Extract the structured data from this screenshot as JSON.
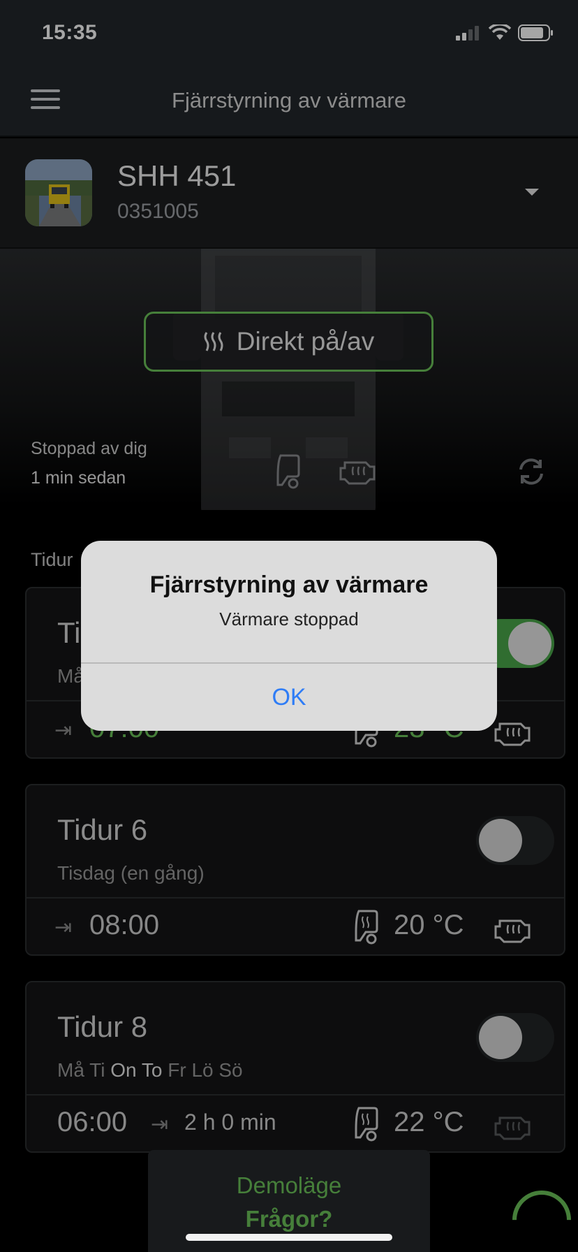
{
  "status_bar": {
    "time": "15:35"
  },
  "header": {
    "title": "Fjärrstyrning av värmare"
  },
  "vehicle": {
    "plate": "SHH 451",
    "id": "0351005"
  },
  "direct": {
    "label": "Direkt på/av"
  },
  "heater_status": {
    "line1": "Stoppad av dig",
    "line2": "1 min sedan"
  },
  "timers_section": {
    "label": "Tidur"
  },
  "timers": [
    {
      "title": "Ti",
      "days": "Må",
      "start": "07:00",
      "temp": "23 °C",
      "enabled": true
    },
    {
      "title": "Tidur 6",
      "days": "Tisdag (en gång)",
      "start": "08:00",
      "temp": "20 °C",
      "enabled": false
    },
    {
      "title": "Tidur 8",
      "days_off_1": "Må Ti",
      "days_on": "On To",
      "days_off_2": "Fr Lö Sö",
      "start": "06:00",
      "duration": "2 h 0 min",
      "temp": "22 °C",
      "enabled": false
    }
  ],
  "demo": {
    "line1": "Demoläge",
    "line2": "Frågor?"
  },
  "alert": {
    "title": "Fjärrstyrning av värmare",
    "message": "Värmare stoppad",
    "button": "OK"
  },
  "colors": {
    "accent": "#6cc35a",
    "ios_blue": "#2f7df6",
    "background": "#000000"
  },
  "icons": [
    "menu-icon",
    "heat-icon",
    "seat-heater-icon",
    "engine-heater-icon",
    "refresh-icon",
    "arrow-icon",
    "chevron-down-icon",
    "signal-icon",
    "wifi-icon",
    "battery-icon"
  ]
}
